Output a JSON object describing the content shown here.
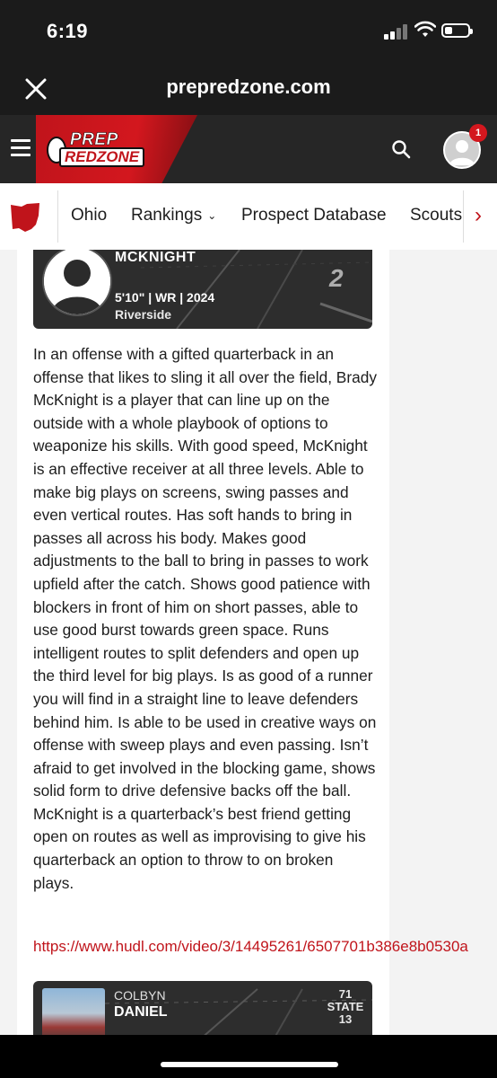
{
  "status_bar": {
    "time": "6:19"
  },
  "browser": {
    "url": "prepredzone.com"
  },
  "site": {
    "logo_top": "PREP",
    "logo_bottom": "REDZONE",
    "notification_count": "1"
  },
  "nav": {
    "items": [
      {
        "label": "Ohio"
      },
      {
        "label": "Rankings"
      },
      {
        "label": "Prospect Database"
      },
      {
        "label": "Scouts"
      }
    ]
  },
  "player": {
    "name": "MCKNIGHT",
    "meta": "5'10\" | WR | 2024",
    "school": "Riverside",
    "jersey": "2"
  },
  "article": {
    "body": "In an offense with a gifted quarterback in an offense that likes to sling it all over the field, Brady McKnight is a player that can line up on the outside with a whole playbook of options to weaponize his skills. With good speed, McKnight is an effective receiver at all three levels. Able to make big plays on screens, swing passes and even vertical routes. Has soft hands to bring in passes all across his body. Makes good adjustments to the ball to bring in passes to work upfield after the catch. Shows good patience with blockers in front of him on short passes, able to use good burst towards green space. Runs intelligent routes to split defenders and open up the third level for big plays. Is as good of a runner you will find in a straight line to leave defenders behind him. Is able to be used in creative ways on offense with sweep plays and even passing. Isn’t afraid to get involved in the blocking game, shows solid form to drive defensive backs off the ball. McKnight is a quarterback’s best friend getting open on routes as well as improvising to give his quarterback an option to throw to on broken plays.",
    "link": "https://www.hudl.com/video/3/14495261/6507701b386e8b0530a"
  },
  "next_player": {
    "first_name": "COLBYN",
    "last_name": "DANIEL",
    "score_top": "71",
    "score_label": "STATE",
    "score_bottom": "13"
  }
}
